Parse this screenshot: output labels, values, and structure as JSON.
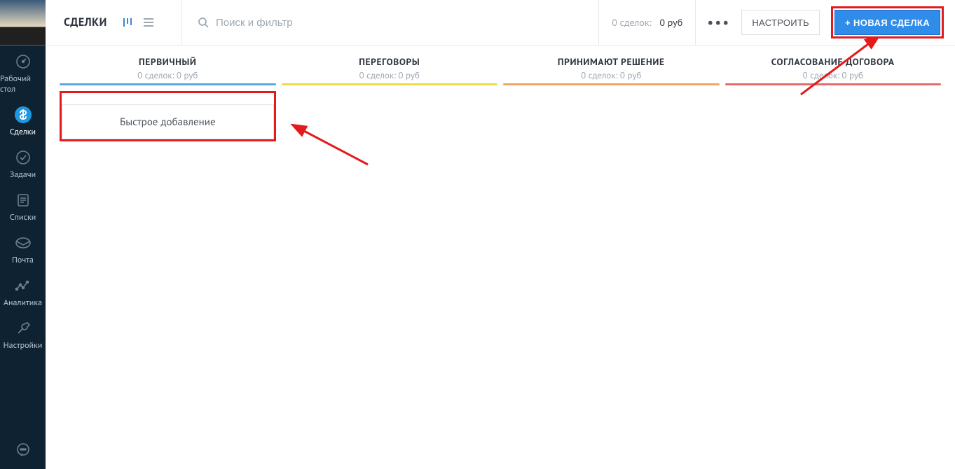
{
  "sidebar": {
    "items": [
      {
        "label": "Рабочий стол"
      },
      {
        "label": "Сделки"
      },
      {
        "label": "Задачи"
      },
      {
        "label": "Списки"
      },
      {
        "label": "Почта"
      },
      {
        "label": "Аналитика"
      },
      {
        "label": "Настройки"
      }
    ]
  },
  "header": {
    "title": "СДЕЛКИ",
    "search_placeholder": "Поиск и фильтр",
    "summary_prefix": "0 сделок:",
    "summary_value": "0 руб",
    "settings_label": "НАСТРОИТЬ",
    "new_deal_label": "НОВАЯ СДЕЛКА"
  },
  "columns": [
    {
      "title": "ПЕРВИЧНЫЙ",
      "sub": "0 сделок: 0 руб",
      "color": "#5aa9e6"
    },
    {
      "title": "ПЕРЕГОВОРЫ",
      "sub": "0 сделок: 0 руб",
      "color": "#f2d84b"
    },
    {
      "title": "ПРИНИМАЮТ РЕШЕНИЕ",
      "sub": "0 сделок: 0 руб",
      "color": "#f0a85a"
    },
    {
      "title": "СОГЛАСОВАНИЕ ДОГОВОРА",
      "sub": "0 сделок: 0 руб",
      "color": "#e66b6b"
    }
  ],
  "quick_add_label": "Быстрое добавление"
}
